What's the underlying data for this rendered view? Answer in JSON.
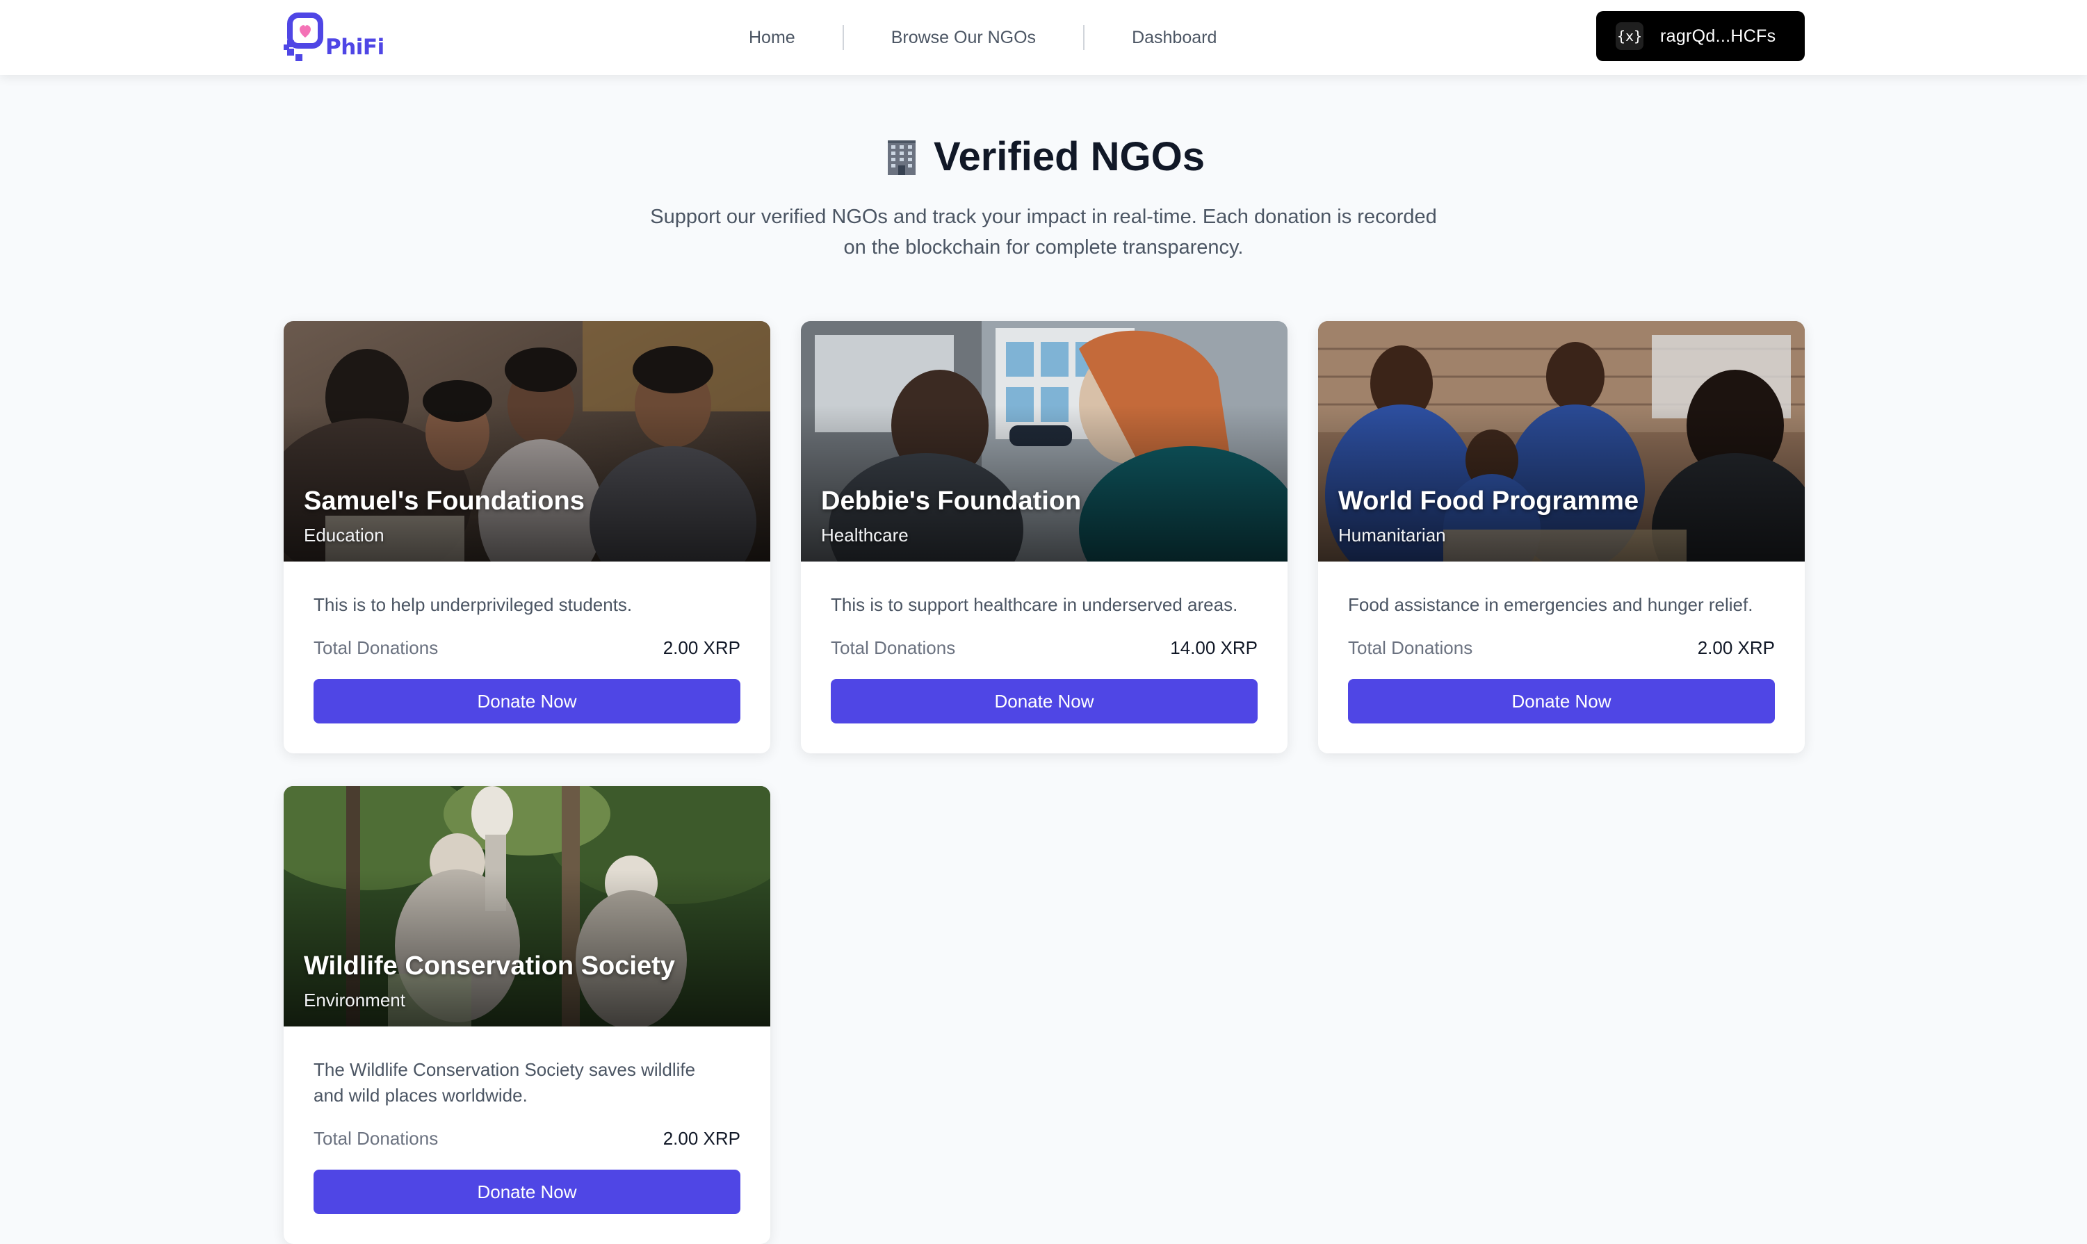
{
  "brand": {
    "name": "PhiFi",
    "accent_color": "#4f46e5"
  },
  "nav": {
    "links": [
      {
        "label": "Home"
      },
      {
        "label": "Browse Our NGOs"
      },
      {
        "label": "Dashboard"
      }
    ]
  },
  "wallet": {
    "icon": "variable-icon",
    "address": "ragrQd...HCFs"
  },
  "header": {
    "icon": "office-building-icon",
    "title": "Verified NGOs",
    "subtitle_line1": "Support our verified NGOs and track your impact in real-time. Each donation is recorded",
    "subtitle_line2": "on the blockchain for complete transparency."
  },
  "cards": [
    {
      "name": "Samuel's Foundations",
      "category": "Education",
      "description": "This is to help underprivileged students.",
      "donations_label": "Total Donations",
      "donations_value": "2.00 XRP",
      "button_label": "Donate Now"
    },
    {
      "name": "Debbie's Foundation",
      "category": "Healthcare",
      "description": "This is to support healthcare in underserved areas.",
      "donations_label": "Total Donations",
      "donations_value": "14.00 XRP",
      "button_label": "Donate Now"
    },
    {
      "name": "World Food Programme",
      "category": "Humanitarian",
      "description": "Food assistance in emergencies and hunger relief.",
      "donations_label": "Total Donations",
      "donations_value": "2.00 XRP",
      "button_label": "Donate Now"
    },
    {
      "name": "Wildlife Conservation Society",
      "category": "Environment",
      "description_line1": "The Wildlife Conservation Society saves wildlife",
      "description_line2": "and wild places worldwide.",
      "donations_label": "Total Donations",
      "donations_value": "2.00 XRP",
      "button_label": "Donate Now"
    }
  ]
}
